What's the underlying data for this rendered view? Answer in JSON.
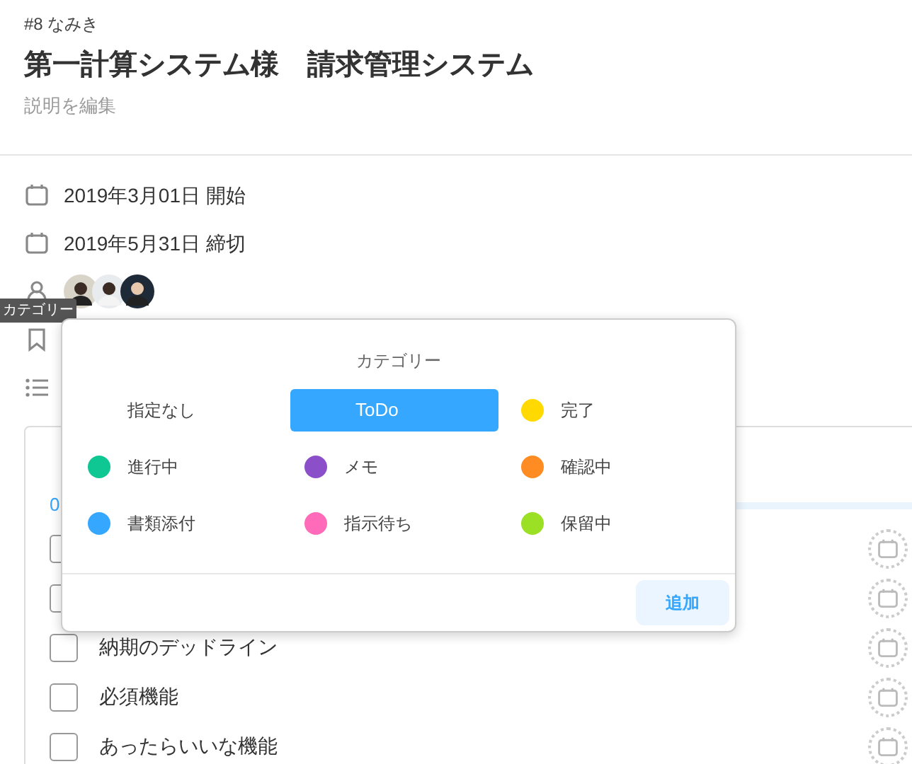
{
  "header": {
    "subtitle": "#8 なみき",
    "title": "第一計算システム様　請求管理システム",
    "edit_link": "説明を編集"
  },
  "dates": [
    {
      "text": "2019年3月01日 開始"
    },
    {
      "text": "2019年5月31日 締切"
    }
  ],
  "tooltip": "カテゴリー",
  "popover": {
    "title": "カテゴリー",
    "categories": [
      {
        "label": "指定なし",
        "selected": false
      },
      {
        "label": "ToDo",
        "selected": true
      },
      {
        "label": "完了",
        "color": "#ffd900",
        "selected": false
      },
      {
        "label": "進行中",
        "color": "#0ec793",
        "selected": false
      },
      {
        "label": "メモ",
        "color": "#8a4fc9",
        "selected": false
      },
      {
        "label": "確認中",
        "color": "#ff8c23",
        "selected": false
      },
      {
        "label": "書類添付",
        "color": "#35a7ff",
        "selected": false
      },
      {
        "label": "指示待ち",
        "color": "#ff6ab9",
        "selected": false
      },
      {
        "label": "保留中",
        "color": "#9be025",
        "selected": false
      }
    ],
    "add_button": "追加"
  },
  "checklist": {
    "progress": "0",
    "level": 0,
    "items": [
      {
        "checked": false
      },
      {
        "checked": false
      },
      {
        "label": "納期のデッドライン",
        "checked": false
      },
      {
        "label": "必須機能",
        "checked": false
      },
      {
        "label": "あったらいいな機能",
        "checked": false
      }
    ]
  }
}
